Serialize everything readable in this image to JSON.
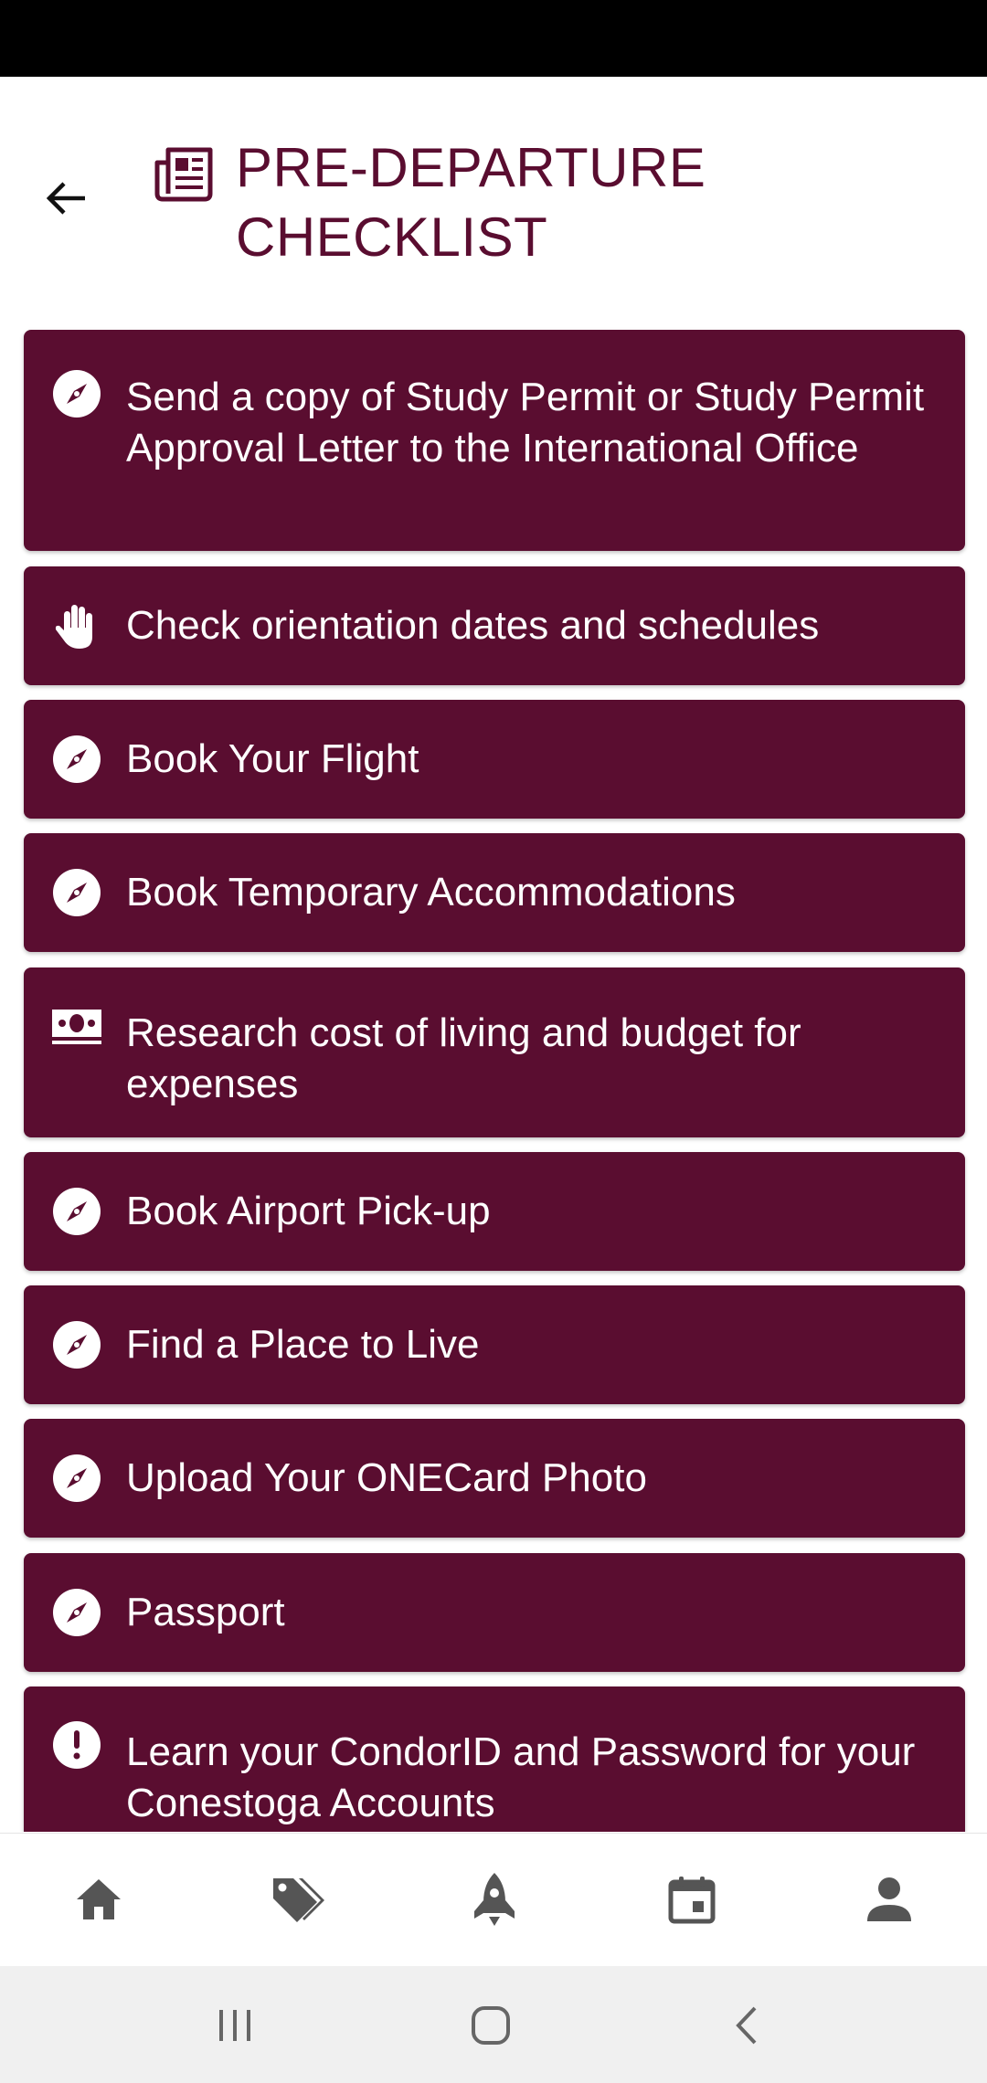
{
  "header": {
    "title": "PRE-DEPARTURE CHECKLIST",
    "back_icon": "arrow-left-icon",
    "title_icon": "newspaper-icon"
  },
  "colors": {
    "brand": "#5a0d30",
    "card_text": "#ffffff",
    "nav_icon": "#555555"
  },
  "checklist": {
    "items": [
      {
        "label": "Send a copy of Study Permit or Study Permit Approval Letter to the International Office",
        "icon": "compass-icon"
      },
      {
        "label": "Check orientation dates and schedules",
        "icon": "hand-icon"
      },
      {
        "label": "Book Your Flight",
        "icon": "compass-icon"
      },
      {
        "label": "Book Temporary Accommodations",
        "icon": "compass-icon"
      },
      {
        "label": "Research cost of living and budget for expenses",
        "icon": "money-bill-icon"
      },
      {
        "label": "Book Airport Pick-up",
        "icon": "compass-icon"
      },
      {
        "label": "Find a Place to Live",
        "icon": "compass-icon"
      },
      {
        "label": "Upload Your ONECard Photo",
        "icon": "compass-icon"
      },
      {
        "label": "Passport",
        "icon": "compass-icon"
      },
      {
        "label": "Learn your CondorID and Password for your Conestoga Accounts",
        "icon": "exclamation-circle-icon"
      }
    ]
  },
  "bottom_nav": {
    "items": [
      "home-icon",
      "tags-icon",
      "rocket-icon",
      "calendar-icon",
      "person-icon"
    ]
  },
  "system_nav": {
    "items": [
      "recent-apps-icon",
      "home-circle-icon",
      "back-chevron-icon"
    ]
  }
}
